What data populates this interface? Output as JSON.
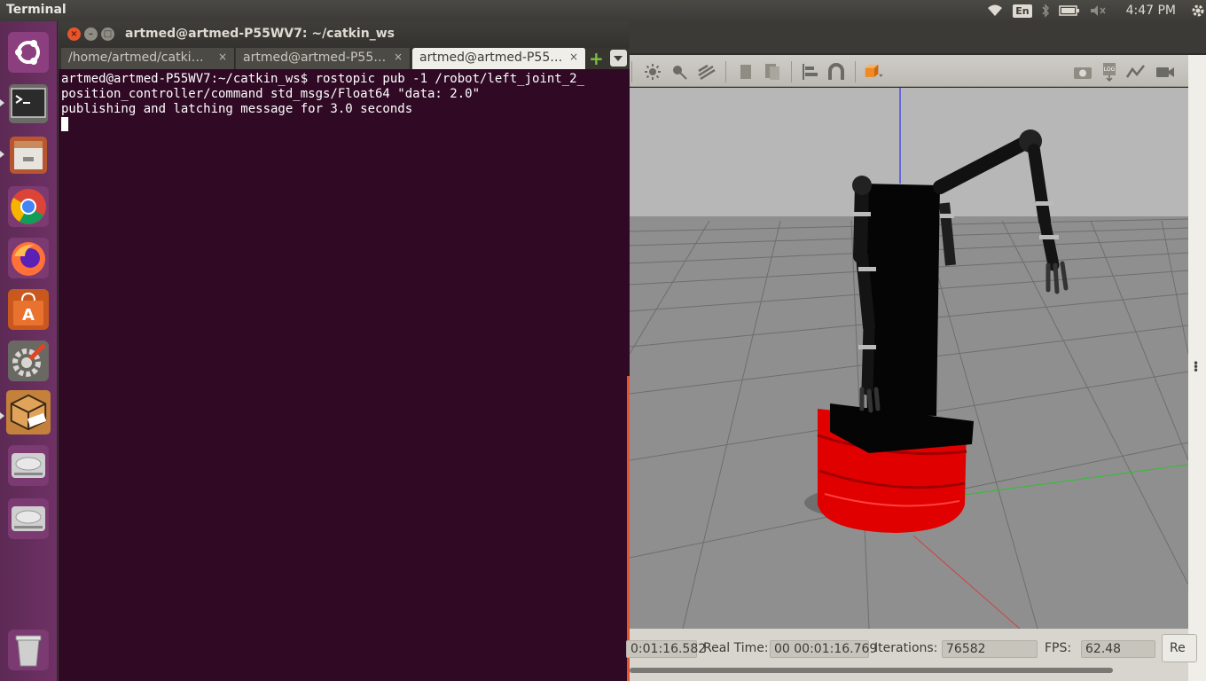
{
  "top_panel": {
    "app_title": "Terminal",
    "keyboard_layout": "En",
    "clock": "4:47 PM",
    "icons": [
      "wifi-icon",
      "keyboard-icon",
      "bluetooth-icon",
      "battery-icon",
      "volume-muted-icon",
      "system-gear-icon"
    ]
  },
  "launcher": {
    "items": [
      "ubuntu-dash",
      "terminal",
      "files",
      "chrome",
      "firefox",
      "software-center",
      "system-settings",
      "sublime-text",
      "disk-1",
      "disk-2",
      "trash"
    ]
  },
  "terminal": {
    "window_title": "artmed@artmed-P55WV7: ~/catkin_ws",
    "tabs": [
      {
        "label": "/home/artmed/catki…",
        "active": false
      },
      {
        "label": "artmed@artmed-P55…",
        "active": false
      },
      {
        "label": "artmed@artmed-P55…",
        "active": true
      }
    ],
    "lines": [
      "artmed@artmed-P55WV7:~/catkin_ws$ rostopic pub -1 /robot/left_joint_2_",
      "position_controller/command std_msgs/Float64 \"data: 2.0\"",
      "publishing and latching message for 3.0 seconds"
    ]
  },
  "gazebo": {
    "status": {
      "sim_time_value": "0:01:16.582",
      "real_time_label": "Real Time:",
      "real_time_value": "00 00:01:16.769",
      "iterations_label": "Iterations:",
      "iterations_value": "76582",
      "fps_label": "FPS:",
      "fps_value": "62.48",
      "reset_button": "Re"
    },
    "colors": {
      "toolbar": "#c6c4bd",
      "ground": "#8e8e8e",
      "robot_base": "#e00000",
      "robot_body": "#050505"
    }
  }
}
